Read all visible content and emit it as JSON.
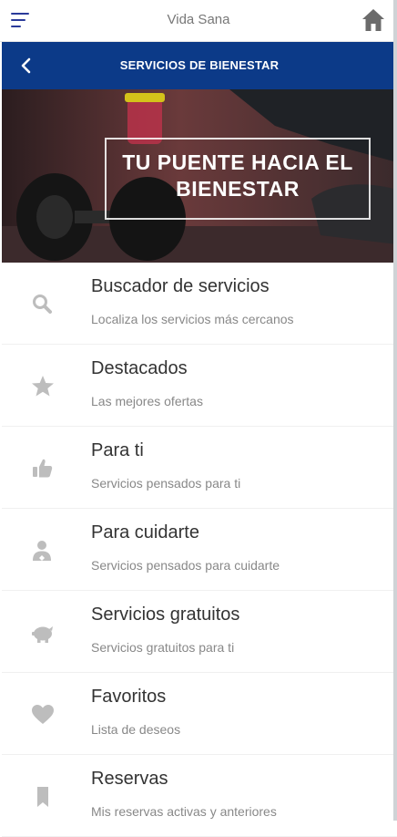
{
  "app": {
    "title": "Vida Sana",
    "icons": {
      "menu": "hamburger-menu-icon",
      "home": "home-icon",
      "back": "chevron-left-icon"
    },
    "colors": {
      "header_bg": "#0c3a88",
      "menu_icon": "#2a3a9a",
      "icon_gray": "#bdbdbd"
    }
  },
  "header": {
    "title": "SERVICIOS DE BIENESTAR"
  },
  "banner": {
    "line1": "TU PUENTE HACIA EL",
    "line2": "BIENESTAR"
  },
  "items": [
    {
      "title": "Buscador de servicios",
      "subtitle": "Localiza los servicios más cercanos",
      "icon": "search-icon"
    },
    {
      "title": "Destacados",
      "subtitle": "Las mejores ofertas",
      "icon": "star-icon"
    },
    {
      "title": "Para ti",
      "subtitle": "Servicios pensados para ti",
      "icon": "thumbs-up-icon"
    },
    {
      "title": "Para cuidarte",
      "subtitle": "Servicios pensados para cuidarte",
      "icon": "user-care-icon"
    },
    {
      "title": "Servicios gratuitos",
      "subtitle": "Servicios gratuitos para ti",
      "icon": "piggy-bank-icon"
    },
    {
      "title": "Favoritos",
      "subtitle": "Lista de deseos",
      "icon": "heart-icon"
    },
    {
      "title": "Reservas",
      "subtitle": "Mis reservas activas y anteriores",
      "icon": "bookmark-icon"
    }
  ]
}
